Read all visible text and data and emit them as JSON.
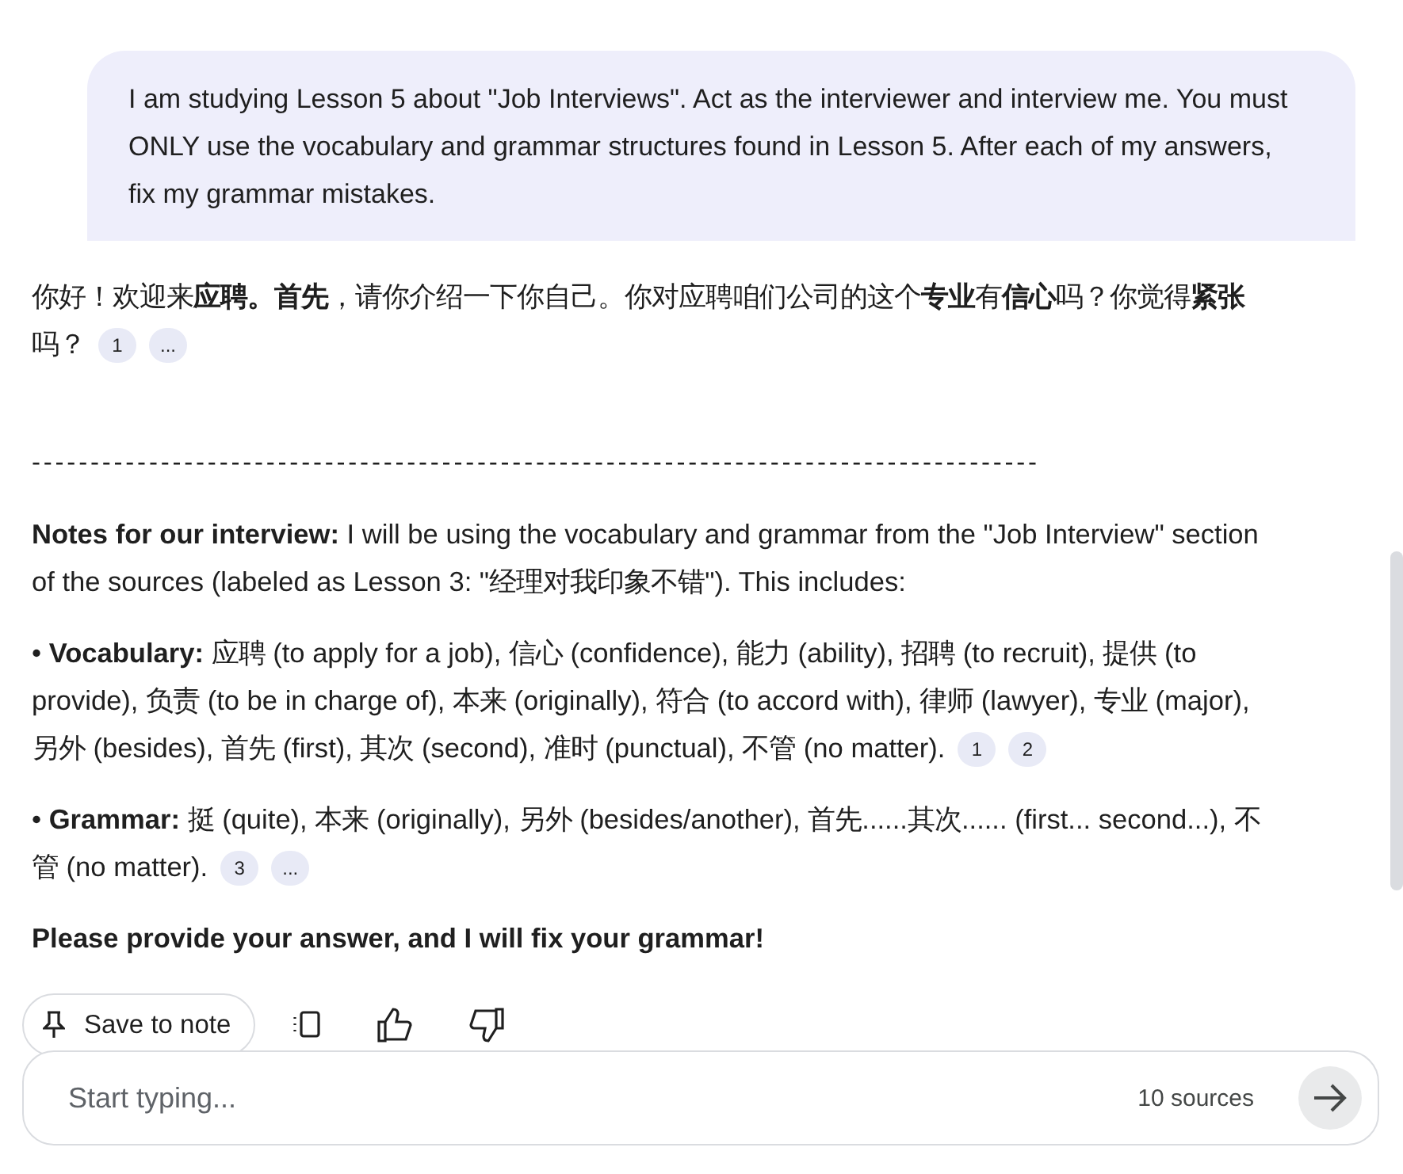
{
  "user_message": "I am studying Lesson 5 about \"Job Interviews\". Act as the interviewer and interview me. You must ONLY use the vocabulary and grammar structures found in Lesson 5. After each of my answers, fix my grammar mistakes.",
  "response": [
    {
      "kind": "text",
      "text": "你好！欢迎来**应聘。首先**，请你介绍一下你自己。你对应聘咱们公司的这个**专业**有**信心**吗？你觉得**紧张**吗？",
      "citations": [
        "1",
        "..."
      ]
    },
    {
      "kind": "rule",
      "text": "--------------------------------------------------------------------------------------"
    },
    {
      "kind": "text",
      "text": "**Notes for our interview:** I will be using the vocabulary and grammar from the \"Job Interview\" section of the sources (labeled as Lesson 3: \"经理对我印象不错\"). This includes:"
    },
    {
      "kind": "text",
      "text": "• **Vocabulary:** 应聘 (to apply for a job), 信心 (confidence), 能力 (ability), 招聘 (to recruit), 提供 (to provide), 负责 (to be in charge of), 本来 (originally), 符合 (to accord with), 律师 (lawyer), 专业 (major), 另外 (besides), 首先 (first), 其次 (second), 准时 (punctual), 不管 (no matter).",
      "citations": [
        "1",
        "2"
      ]
    },
    {
      "kind": "text",
      "text": "• **Grammar:** 挺 (quite), 本来 (originally), 另外 (besides/another), 首先......其次...... (first... second...), 不管 (no matter).",
      "citations": [
        "3",
        "..."
      ]
    },
    {
      "kind": "bold",
      "text": "Please provide your answer, and I will fix your grammar!"
    }
  ],
  "save_button": "Save to note",
  "composer": {
    "placeholder": "Start typing...",
    "sources": "10 sources"
  }
}
